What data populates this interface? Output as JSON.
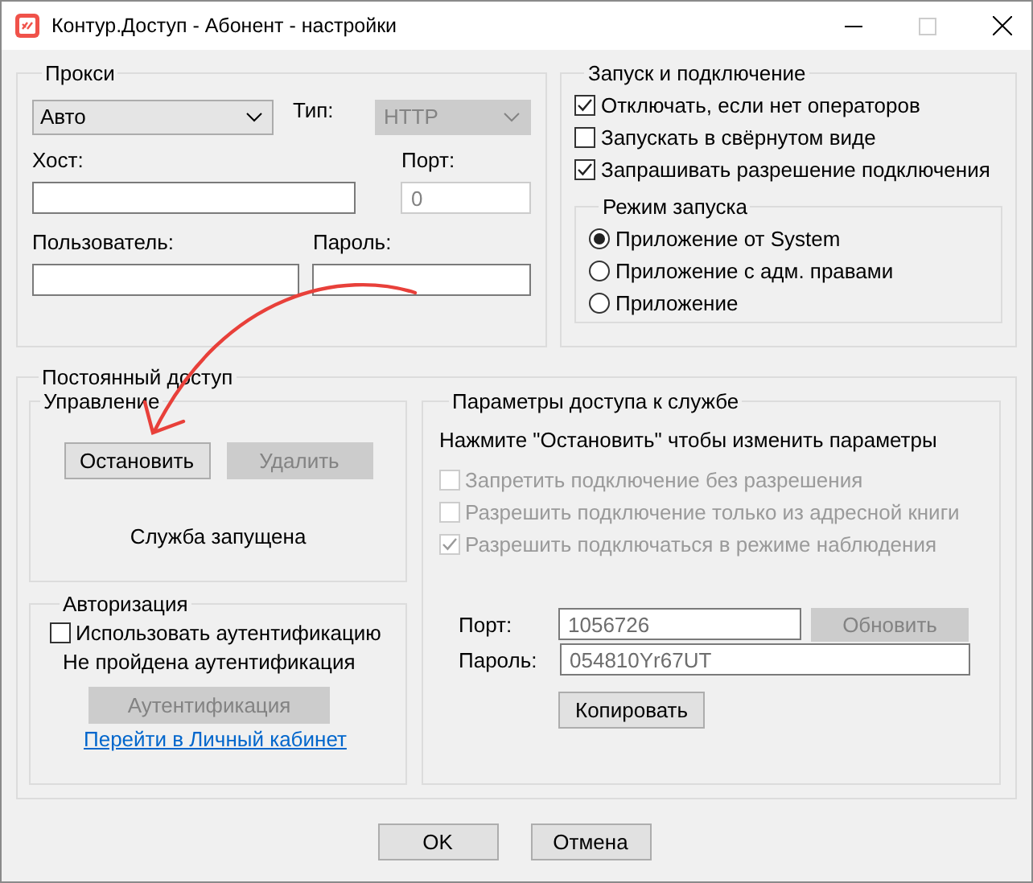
{
  "window": {
    "title": "Контур.Доступ - Абонент - настройки"
  },
  "proxy": {
    "legend": "Прокси",
    "mode": {
      "value": "Авто",
      "disabled": false
    },
    "type_label": "Тип:",
    "type": {
      "value": "HTTP",
      "disabled": true
    },
    "host_label": "Хост:",
    "port_label": "Порт:",
    "port": {
      "value": "0",
      "disabled": true
    },
    "user_label": "Пользователь:",
    "password_label": "Пароль:"
  },
  "startup": {
    "legend": "Запуск и подключение",
    "options": [
      {
        "label": "Отключать, если нет операторов",
        "checked": true
      },
      {
        "label": "Запускать в свёрнутом виде",
        "checked": false
      },
      {
        "label": "Запрашивать разрешение подключения",
        "checked": true
      }
    ],
    "launch_mode": {
      "legend": "Режим запуска",
      "options": [
        {
          "label": "Приложение от System",
          "selected": true
        },
        {
          "label": "Приложение с адм. правами",
          "selected": false
        },
        {
          "label": "Приложение",
          "selected": false
        }
      ]
    }
  },
  "persistent": {
    "legend": "Постоянный доступ",
    "control": {
      "legend": "Управление",
      "buttons": [
        {
          "label": "Остановить",
          "disabled": false
        },
        {
          "label": "Удалить",
          "disabled": true
        }
      ],
      "status": "Служба запущена"
    },
    "auth": {
      "legend": "Авторизация",
      "use_auth": {
        "label": "Использовать аутентификацию",
        "checked": false
      },
      "status": "Не пройдена аутентификация",
      "button": {
        "label": "Аутентификация",
        "disabled": true
      },
      "link": "Перейти в Личный кабинет"
    },
    "service": {
      "legend": "Параметры доступа к службе",
      "hint": "Нажмите \"Остановить\" чтобы изменить параметры",
      "options": [
        {
          "label": "Запретить подключение без разрешения",
          "checked": false,
          "disabled": true
        },
        {
          "label": "Разрешить подключение только из адресной книги",
          "checked": false,
          "disabled": true
        },
        {
          "label": "Разрешить подключаться в режиме наблюдения",
          "checked": true,
          "disabled": true
        }
      ],
      "port_label": "Порт:",
      "port": {
        "value": "1056726",
        "disabled": true
      },
      "refresh": {
        "label": "Обновить",
        "disabled": true
      },
      "password_label": "Пароль:",
      "password": {
        "value": "054810Yr67UT",
        "disabled": true
      },
      "copy": {
        "label": "Копировать",
        "disabled": false
      }
    }
  },
  "buttons": [
    "OK",
    "Отмена"
  ]
}
